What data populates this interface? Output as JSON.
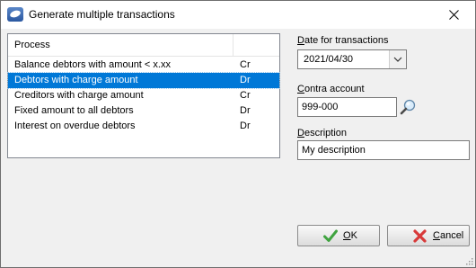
{
  "window": {
    "title": "Generate multiple transactions"
  },
  "process_list": {
    "header": "Process",
    "rows": [
      {
        "name": "Balance debtors with amount < x.xx",
        "type": "Cr"
      },
      {
        "name": "Debtors with charge amount",
        "type": "Dr",
        "selected": true
      },
      {
        "name": "Creditors with charge amount",
        "type": "Cr"
      },
      {
        "name": "Fixed amount to all debtors",
        "type": "Dr"
      },
      {
        "name": "Interest on overdue debtors",
        "type": "Dr"
      }
    ]
  },
  "date_field": {
    "label_first": "D",
    "label_rest": "ate for transactions",
    "value": "2021/04/30"
  },
  "contra_field": {
    "label_first": "C",
    "label_rest": "ontra account",
    "value": "999-000"
  },
  "description_field": {
    "label_first": "D",
    "label_rest": "escription",
    "value": "My description"
  },
  "buttons": {
    "ok_first": "O",
    "ok_rest": "K",
    "cancel_first": "C",
    "cancel_rest": "ancel"
  },
  "icons": [
    "dialog-app-icon",
    "close-icon",
    "dropdown-arrow-icon",
    "magnifier-icon",
    "checkmark-icon",
    "cross-icon",
    "resize-grip-icon"
  ],
  "colors": {
    "selection": "#0078d7",
    "ok_check": "#3fa33f",
    "cancel_cross": "#d83a3a"
  }
}
